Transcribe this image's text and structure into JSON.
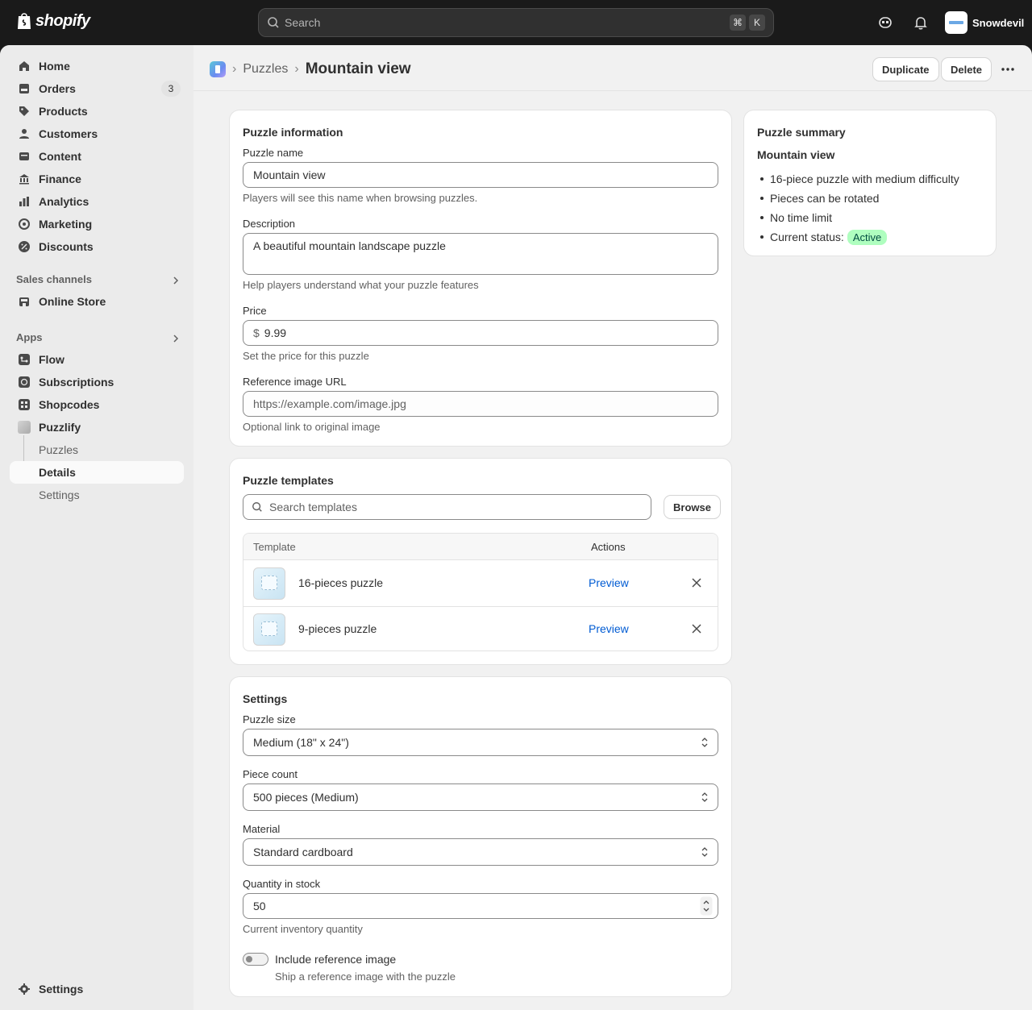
{
  "topbar": {
    "logo_text": "shopify",
    "search_placeholder": "Search",
    "shortcut_keys": [
      "⌘",
      "K"
    ],
    "store_name": "Snowdevil"
  },
  "sidebar": {
    "items": [
      {
        "label": "Home",
        "icon": "home-icon"
      },
      {
        "label": "Orders",
        "icon": "orders-icon",
        "badge": "3"
      },
      {
        "label": "Products",
        "icon": "tag-icon"
      },
      {
        "label": "Customers",
        "icon": "person-icon"
      },
      {
        "label": "Content",
        "icon": "content-icon"
      },
      {
        "label": "Finance",
        "icon": "bank-icon"
      },
      {
        "label": "Analytics",
        "icon": "chart-icon"
      },
      {
        "label": "Marketing",
        "icon": "target-icon"
      },
      {
        "label": "Discounts",
        "icon": "discount-icon"
      }
    ],
    "sales_channels_label": "Sales channels",
    "online_store_label": "Online Store",
    "apps_label": "Apps",
    "apps": [
      {
        "label": "Flow"
      },
      {
        "label": "Subscriptions"
      },
      {
        "label": "Shopcodes"
      },
      {
        "label": "Puzzlify"
      }
    ],
    "subitems": [
      {
        "label": "Puzzles"
      },
      {
        "label": "Details"
      },
      {
        "label": "Settings"
      }
    ],
    "settings_label": "Settings"
  },
  "header": {
    "breadcrumb_parent": "Puzzles",
    "title": "Mountain view",
    "duplicate_label": "Duplicate",
    "delete_label": "Delete"
  },
  "puzzle_info": {
    "title": "Puzzle information",
    "name_label": "Puzzle name",
    "name_value": "Mountain view",
    "name_help": "Players will see this name when browsing puzzles.",
    "description_label": "Description",
    "description_value": "A beautiful mountain landscape puzzle",
    "description_help": "Help players understand what your puzzle features",
    "price_label": "Price",
    "price_prefix": "$",
    "price_value": "9.99",
    "price_help": "Set the price for this puzzle",
    "url_label": "Reference image URL",
    "url_placeholder": "https://example.com/image.jpg",
    "url_help": "Optional link to original image"
  },
  "templates": {
    "title": "Puzzle templates",
    "search_placeholder": "Search templates",
    "browse_label": "Browse",
    "col_template": "Template",
    "col_actions": "Actions",
    "rows": [
      {
        "name": "16-pieces puzzle",
        "action": "Preview"
      },
      {
        "name": "9-pieces puzzle",
        "action": "Preview"
      }
    ]
  },
  "settings": {
    "title": "Settings",
    "size_label": "Puzzle size",
    "size_value": "Medium (18\" x 24\")",
    "count_label": "Piece count",
    "count_value": "500 pieces (Medium)",
    "material_label": "Material",
    "material_value": "Standard cardboard",
    "quantity_label": "Quantity in stock",
    "quantity_value": "50",
    "quantity_help": "Current inventory quantity",
    "toggle_label": "Include reference image",
    "toggle_help": "Ship a reference image with the puzzle"
  },
  "summary": {
    "title": "Puzzle summary",
    "name": "Mountain view",
    "bullets": [
      "16-piece puzzle with medium difficulty",
      "Pieces can be rotated",
      "No time limit"
    ],
    "status_label": "Current status:",
    "status_value": "Active"
  },
  "colors": {
    "accent_link": "#005bd3",
    "status_active_bg": "#affebf"
  }
}
